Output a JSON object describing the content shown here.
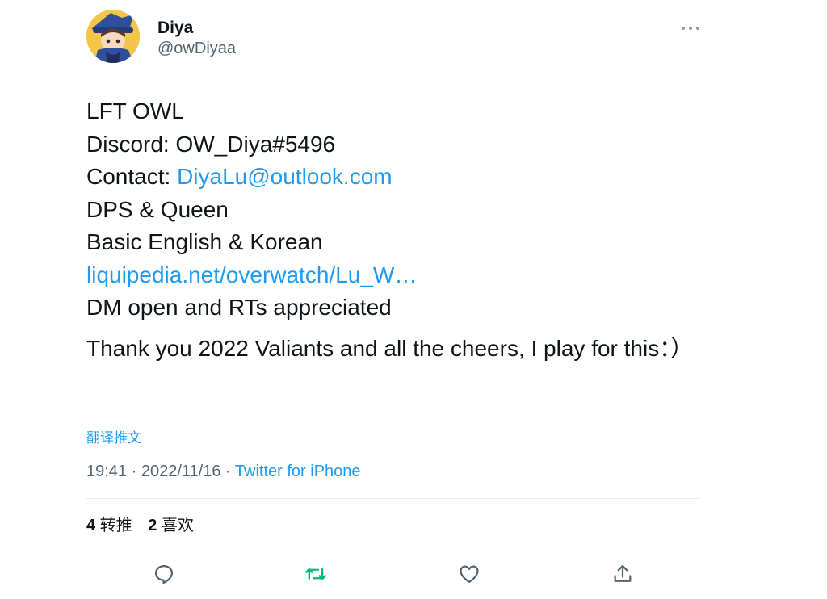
{
  "author": {
    "name": "Diya",
    "handle": "@owDiyaa"
  },
  "tweet": {
    "lines": [
      {
        "text": "LFT  OWL"
      },
      {
        "text": "Discord: OW_Diya#5496"
      },
      {
        "prefix": "Contact: ",
        "link": "DiyaLu@outlook.com"
      },
      {
        "text": "DPS & Queen"
      },
      {
        "text": "Basic English & Korean"
      },
      {
        "link": "liquipedia.net/overwatch/Lu_W…"
      },
      {
        "text": "DM open and RTs appreciated"
      }
    ],
    "paragraph2": "Thank you 2022 Valiants and all the cheers, I play for this：）",
    "translate_label": "翻译推文",
    "time": "19:41",
    "date": "2022/11/16",
    "sep": "·",
    "source": "Twitter for iPhone"
  },
  "stats": {
    "retweets_count": "4",
    "retweets_label": "转推",
    "likes_count": "2",
    "likes_label": "喜欢"
  },
  "icons": {
    "more": "more-horizontal-icon",
    "reply": "reply-icon",
    "retweet": "retweet-icon",
    "like": "heart-icon",
    "share": "share-icon"
  },
  "colors": {
    "link": "#1d9bf0",
    "secondary_text": "#536471",
    "retweet_green": "#00ba7c",
    "icon_gray": "#536471"
  }
}
